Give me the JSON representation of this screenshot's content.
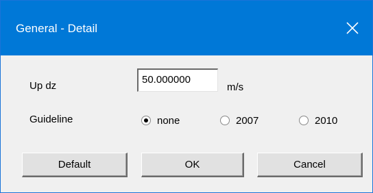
{
  "window": {
    "title": "General - Detail",
    "close_icon": "close-icon",
    "titlebar_color": "#0078d7"
  },
  "form": {
    "up_dz": {
      "label": "Up dz",
      "value": "50.000000",
      "unit": "m/s"
    },
    "guideline": {
      "label": "Guideline",
      "selected": "none",
      "options": [
        {
          "label": "none",
          "checked": true
        },
        {
          "label": "2007",
          "checked": false
        },
        {
          "label": "2010",
          "checked": false
        }
      ]
    }
  },
  "buttons": {
    "default_label": "Default",
    "ok_label": "OK",
    "cancel_label": "Cancel"
  }
}
